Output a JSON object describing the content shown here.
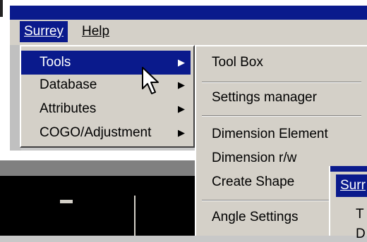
{
  "menubar": {
    "surrey": "Surrey",
    "help": "Help"
  },
  "surrey_menu": {
    "items": [
      {
        "label": "Tools",
        "has_submenu": true,
        "selected": true
      },
      {
        "label": "Database",
        "has_submenu": true
      },
      {
        "label": "Attributes",
        "has_submenu": true
      },
      {
        "label": "COGO/Adjustment",
        "has_submenu": true
      }
    ]
  },
  "tools_submenu": {
    "items": [
      {
        "label": "Tool Box"
      },
      {
        "label": "Settings manager"
      },
      {
        "label": "Dimension Element"
      },
      {
        "label": "Dimension r/w"
      },
      {
        "label": "Create Shape"
      },
      {
        "label": "Angle Settings"
      }
    ]
  },
  "second_window": {
    "menu_surrey": "Surr",
    "item_1": "T",
    "item_2": "D"
  },
  "colors": {
    "highlight": "#0a1a8c",
    "menu_bg": "#d4d0c8"
  }
}
